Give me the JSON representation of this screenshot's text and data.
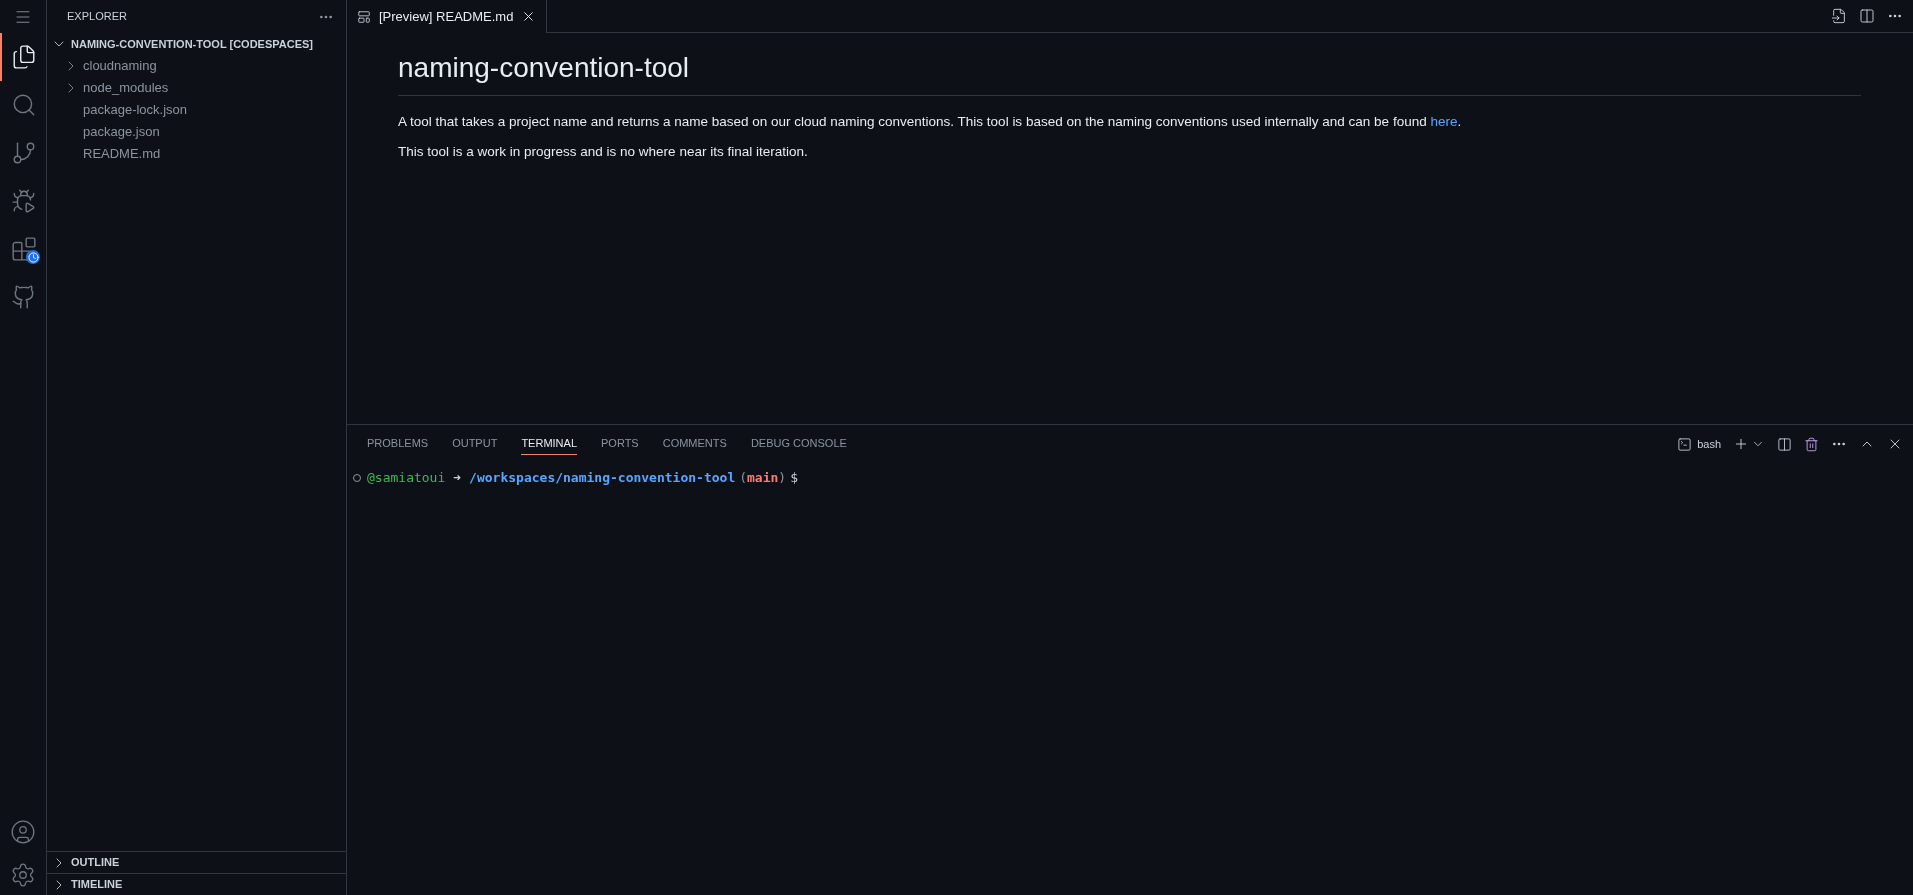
{
  "sidebar": {
    "title": "EXPLORER",
    "root": {
      "label": "NAMING-CONVENTION-TOOL [CODESPACES]",
      "expanded": true,
      "children": [
        {
          "label": "cloudnaming",
          "kind": "folder",
          "expanded": false
        },
        {
          "label": "node_modules",
          "kind": "folder",
          "expanded": false
        },
        {
          "label": "package-lock.json",
          "kind": "file"
        },
        {
          "label": "package.json",
          "kind": "file"
        },
        {
          "label": "README.md",
          "kind": "file"
        }
      ]
    },
    "sections": [
      {
        "label": "OUTLINE",
        "expanded": false
      },
      {
        "label": "TIMELINE",
        "expanded": false
      }
    ]
  },
  "activity_bar": {
    "items": [
      {
        "kind": "explorer",
        "selected": true
      },
      {
        "kind": "search",
        "selected": false
      },
      {
        "kind": "source-control",
        "selected": false
      },
      {
        "kind": "run",
        "selected": false
      },
      {
        "kind": "extensions",
        "selected": false
      },
      {
        "kind": "github",
        "selected": false
      }
    ]
  },
  "editor": {
    "tabs": [
      {
        "label": "[Preview] README.md",
        "selected": true
      }
    ],
    "preview": {
      "heading": "naming-convention-tool",
      "paragraphs": [
        [
          {
            "text": "A tool that takes a project name and returns a name based on our cloud naming conventions. This tool is based on the naming conventions used internally and can be found ",
            "kind": "text"
          },
          {
            "text": "here",
            "kind": "link"
          },
          {
            "text": ".",
            "kind": "text"
          }
        ],
        [
          {
            "text": "This tool is a work in progress and is no where near its final iteration.",
            "kind": "text"
          }
        ]
      ]
    }
  },
  "panel": {
    "tabs": [
      {
        "label": "PROBLEMS",
        "selected": false
      },
      {
        "label": "OUTPUT",
        "selected": false
      },
      {
        "label": "TERMINAL",
        "selected": true
      },
      {
        "label": "PORTS",
        "selected": false
      },
      {
        "label": "COMMENTS",
        "selected": false
      },
      {
        "label": "DEBUG CONSOLE",
        "selected": false
      }
    ],
    "shell": "bash",
    "prompt": [
      {
        "text": "@samiatoui",
        "kind": "user"
      },
      {
        "text": "➜",
        "kind": "arrow"
      },
      {
        "text": "/workspaces/naming-convention-tool",
        "kind": "path"
      },
      {
        "text": "(",
        "kind": "paren"
      },
      {
        "text": "main",
        "kind": "branch"
      },
      {
        "text": ")",
        "kind": "paren"
      },
      {
        "text": "$",
        "kind": "sign"
      }
    ]
  }
}
